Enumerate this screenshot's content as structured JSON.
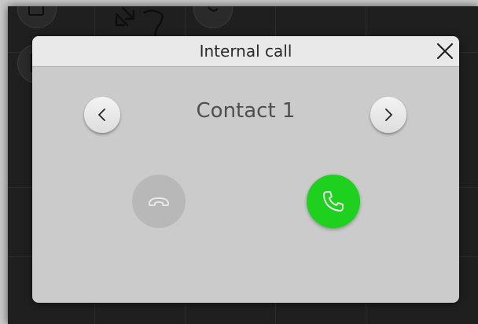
{
  "dialog": {
    "title": "Internal call",
    "contact_name": "Contact 1"
  },
  "icons": {
    "close": "close-icon",
    "previous": "chevron-left-icon",
    "next": "chevron-right-icon",
    "hang_up": "phone-hangup-icon",
    "answer": "phone-icon"
  },
  "colors": {
    "answer_button": "#1fd11f",
    "hangup_button_disabled": "#b8b8b8",
    "dialog_body": "#cbcbcb",
    "dialog_header": "#e9e9e9",
    "app_background": "#1f1f1f"
  },
  "state": {
    "hangup_enabled": false,
    "answer_enabled": true
  }
}
